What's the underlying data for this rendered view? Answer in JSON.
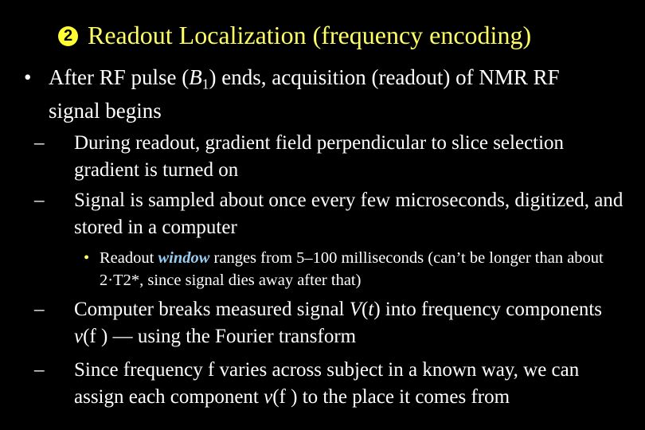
{
  "slide": {
    "title_number": "2",
    "title": "Readout Localization (frequency encoding)",
    "colors": {
      "background": "#000000",
      "title": "#ffff66",
      "text": "#ffffff",
      "accent": "#99ccee"
    },
    "bullet1": {
      "a": "After RF pulse (",
      "var": "B",
      "sub": "1",
      "b": ") ends, acquisition (readout) of NMR RF signal begins"
    },
    "sub1": "During readout, gradient field perpendicular to slice selection gradient is turned on",
    "sub2": "Signal is sampled about once every few microseconds, digitized, and stored in a computer",
    "subsub1": {
      "a": "Readout ",
      "accent": "window",
      "b": " ranges from 5–100 milliseconds (can’t be longer than about 2·T2*, since signal dies away after that)"
    },
    "sub3": {
      "a": "Computer breaks measured signal ",
      "v1": "V",
      "p1": "(",
      "t": "t",
      "b": ") into frequency components ",
      "v2": "v",
      "c": "(f ) — using the Fourier transform"
    },
    "sub4": {
      "a": "Since frequency f varies across subject in a known way, we can assign each component ",
      "v": "v",
      "b": "(f ) to the place it comes from"
    },
    "bullet_glyph": "•",
    "dash_glyph": "–"
  }
}
